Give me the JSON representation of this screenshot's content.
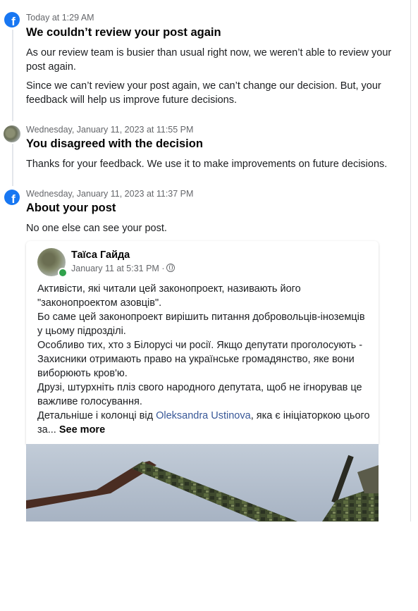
{
  "entries": [
    {
      "icon": "facebook-icon",
      "timestamp": "Today at 1:29 AM",
      "title": "We couldn’t review your post again",
      "paragraphs": [
        "As our review team is busier than usual right now, we weren’t able to review your post again.",
        "Since we can’t review your post again, we can’t change our decision. But, your feedback will help us improve future decisions."
      ]
    },
    {
      "icon": "user-avatar",
      "timestamp": "Wednesday, January 11, 2023 at 11:55 PM",
      "title": "You disagreed with the decision",
      "paragraphs": [
        "Thanks for your feedback. We use it to make improvements on future decisions."
      ]
    },
    {
      "icon": "facebook-icon",
      "timestamp": "Wednesday, January 11, 2023 at 11:37 PM",
      "title": "About your post",
      "paragraphs": [
        "No one else can see your post."
      ]
    }
  ],
  "post": {
    "author": "Таїса Гайда",
    "date": "January 11 at 5:31 PM ·",
    "body_lines": [
      "Активісти, які читали цей законопроект, називають його \"законопроектом азовців\".",
      "Бо саме цей законопроект вирішить питання добровольців-іноземців у цьому підрозділі.",
      " Особливо тих, хто з Білорусі чи росії. Якщо депутати проголосують - Захисники отримають право на українське громадянство, яке вони виборюють кров'ю.",
      "Друзі, штурхніть пліз свого народного депутата, щоб не ігнорував це важливе голосування."
    ],
    "last_line_prefix": "Детальніше і колонці від ",
    "link_text": "Oleksandra Ustinova",
    "last_line_suffix": ", яка є ініціаторкою цього за...",
    "see_more": "See more"
  },
  "colors": {
    "facebook_blue": "#1877f2",
    "online_green": "#31a24c",
    "link": "#385898"
  }
}
